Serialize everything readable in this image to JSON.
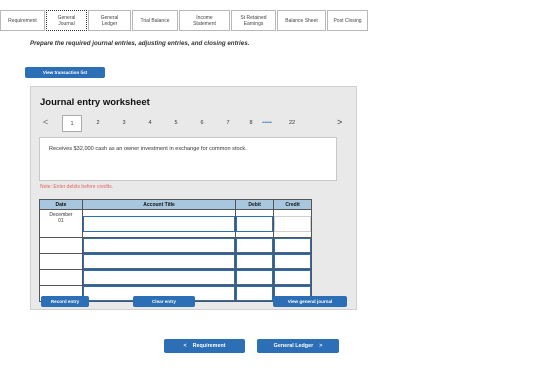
{
  "tabs": [
    {
      "label": "Requirement",
      "active": false
    },
    {
      "label": "General\nJournal",
      "active": true
    },
    {
      "label": "General\nLedger",
      "active": false
    },
    {
      "label": "Trial Balance",
      "active": false
    },
    {
      "label": "Income\nStatement",
      "active": false
    },
    {
      "label": "St Retained\nEarnings",
      "active": false
    },
    {
      "label": "Balance Sheet",
      "active": false
    },
    {
      "label": "Post Closing",
      "active": false
    }
  ],
  "instruction": "Prepare the required journal entries, adjusting entries, and closing entries.",
  "view_transaction_list": "View transaction list",
  "worksheet": {
    "title": "Journal entry worksheet",
    "pages": [
      "1",
      "2",
      "3",
      "4",
      "5",
      "6",
      "7",
      "8"
    ],
    "ellipsis": "•••••",
    "last_page": "22",
    "prev_arrow": "<",
    "next_arrow": ">",
    "description": "Receives $32,000 cash as an owner investment in exchange for common stock.",
    "note": "Note: Enter debits before credits.",
    "columns": {
      "date": "Date",
      "account": "Account Title",
      "debit": "Debit",
      "credit": "Credit"
    },
    "date_month": "December",
    "date_day": "01",
    "record_entry": "Record entry",
    "clear_entry": "Clear entry",
    "view_general_journal": "View general journal"
  },
  "footer": {
    "prev_label": "Requirement",
    "next_label": "General Ledger",
    "prev_arrow": "<",
    "next_arrow": ">"
  }
}
